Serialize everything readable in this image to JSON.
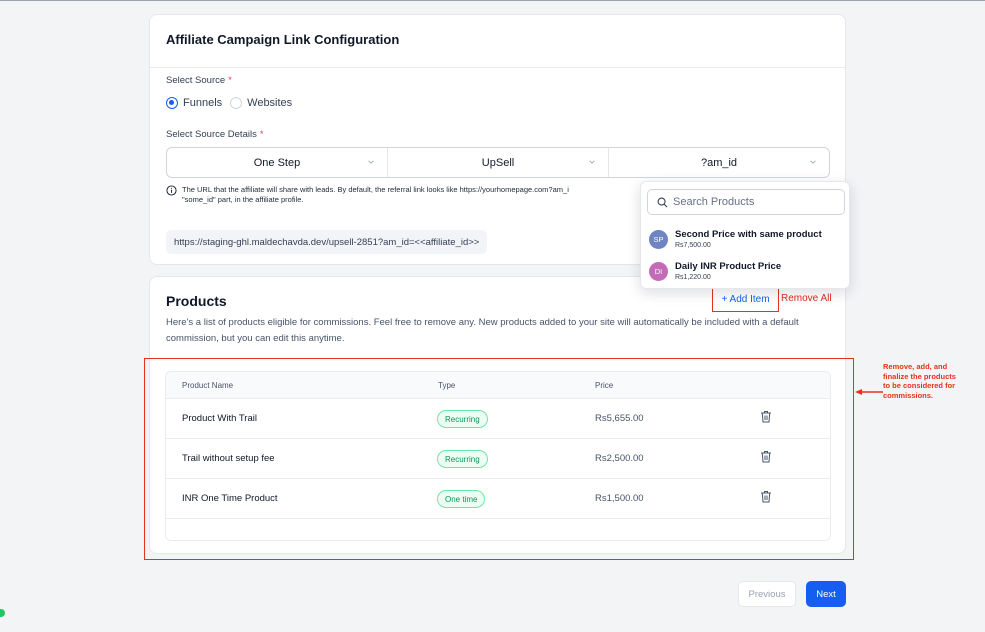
{
  "config": {
    "title": "Affiliate Campaign Link Configuration",
    "source_label": "Select Source",
    "required_mark": "*",
    "source_options": [
      "Funnels",
      "Websites"
    ],
    "source_selected": "Funnels",
    "details_label": "Select Source Details",
    "selects": [
      "One Step",
      "UpSell",
      "?am_id"
    ],
    "info_text": "The URL that the affiliate will share with leads. By default, the referral link looks like https://yourhomepage.com?am_i",
    "info_text_2": "\"some_id\" part, in the affiliate profile.",
    "url": "https://staging-ghl.maldechavda.dev/upsell-2851?am_id=<<affiliate_id>>"
  },
  "dropdown": {
    "search_placeholder": "Search Products",
    "items": [
      {
        "initials": "SP",
        "name": "Second Price with same product",
        "price": "Rs7,500.00",
        "avatar_color": "#6f85c1",
        "initials_color": "#ffffff"
      },
      {
        "initials": "DI",
        "name": "Daily INR Product Price",
        "price": "Rs1,220.00",
        "avatar_color": "#c46bb8",
        "initials_color": "#ffffff"
      }
    ]
  },
  "products": {
    "title": "Products",
    "description": "Here's a list of products eligible for commissions. Feel free to remove any. New products added to your site will automatically be included with a default commission, but you can edit this anytime.",
    "add_item": "+ Add Item",
    "remove_all": "Remove All",
    "columns": [
      "Product Name",
      "Type",
      "Price"
    ],
    "rows": [
      {
        "name": "Product With Trail",
        "type": "Recurring",
        "price": "Rs5,655.00"
      },
      {
        "name": "Trail without setup fee",
        "type": "Recurring",
        "price": "Rs2,500.00"
      },
      {
        "name": "INR One Time Product",
        "type": "One time",
        "price": "Rs1,500.00"
      }
    ]
  },
  "annotation": "Remove, add, and finalize the products to be considered for commissions.",
  "buttons": {
    "previous": "Previous",
    "next": "Next"
  },
  "colors": {
    "accent": "#155eef",
    "annotation_red": "#e5321c",
    "badge_green": "#039855"
  },
  "icons": [
    "info-icon",
    "chevron-down-icon",
    "search-icon",
    "trash-icon",
    "arrow-left-icon"
  ]
}
